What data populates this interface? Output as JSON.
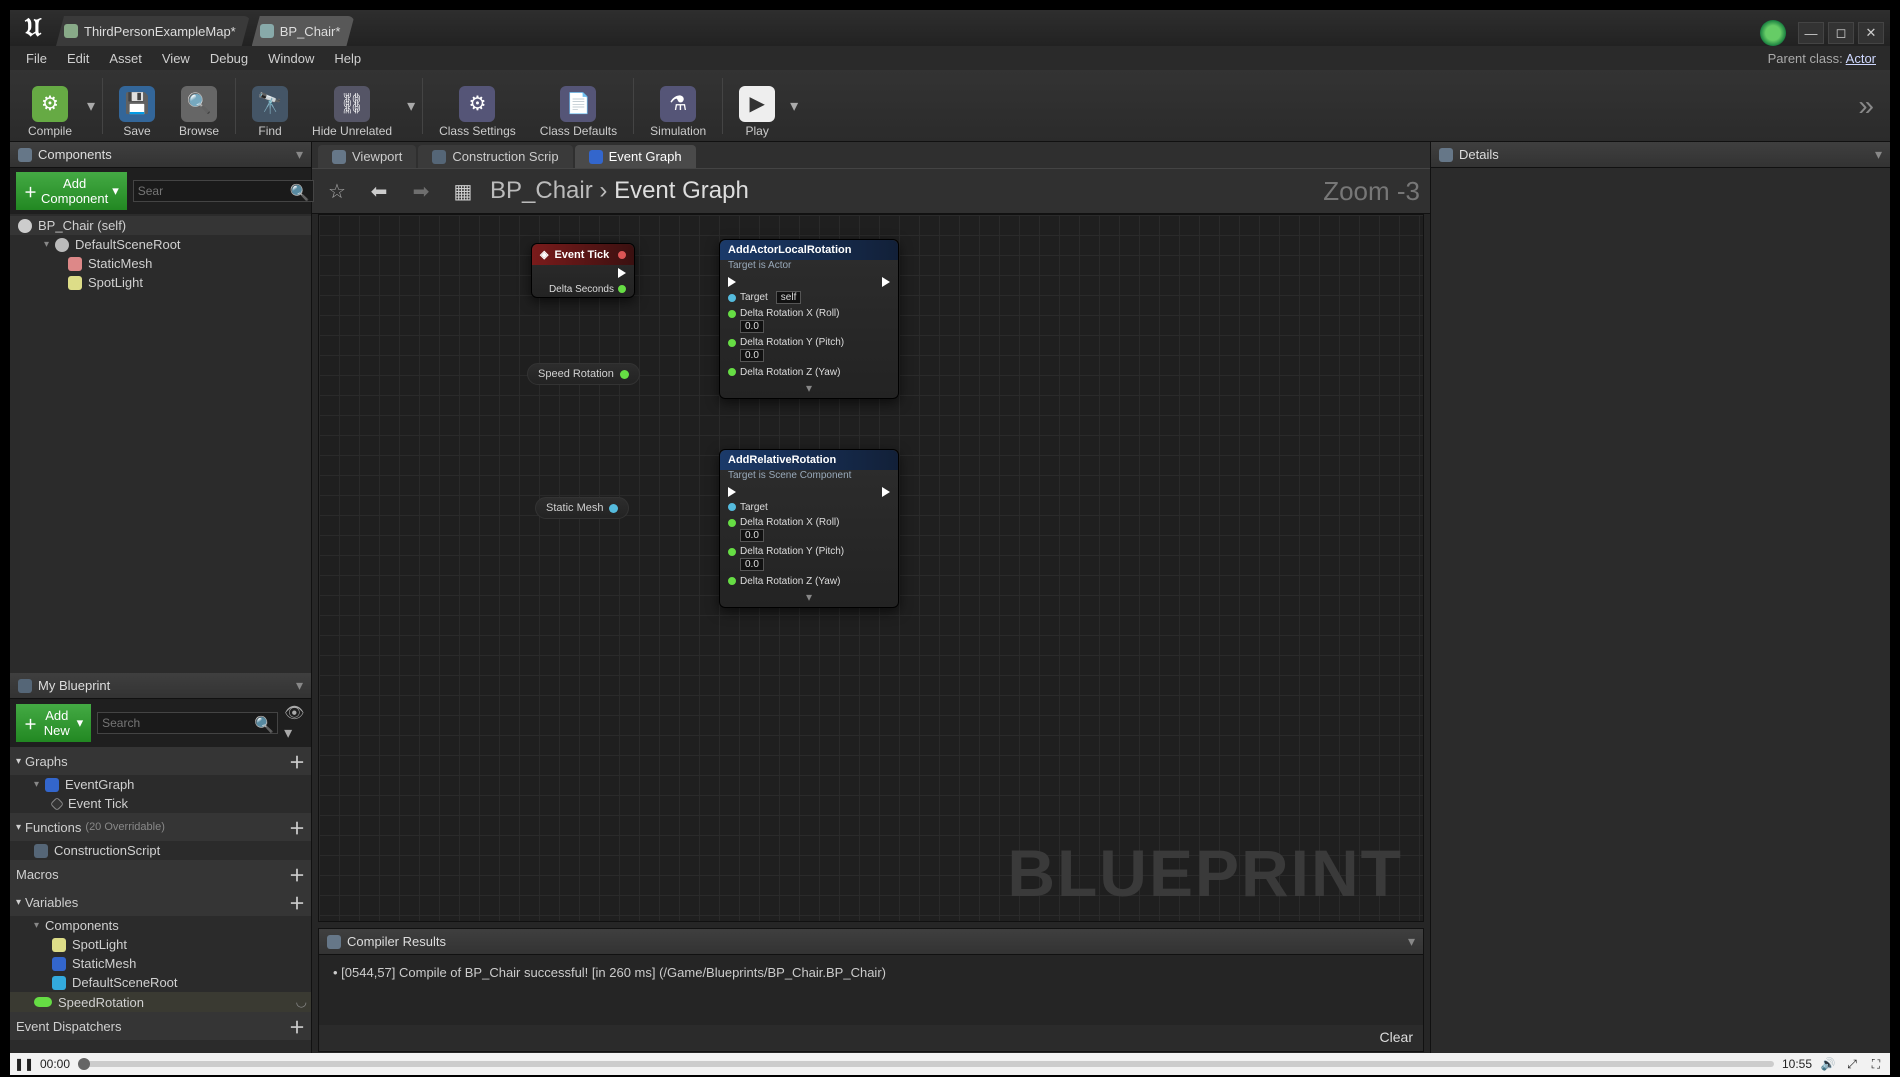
{
  "titlebar": {
    "tabs": [
      {
        "label": "ThirdPersonExampleMap*"
      },
      {
        "label": "BP_Chair*"
      }
    ]
  },
  "menubar": {
    "items": [
      "File",
      "Edit",
      "Asset",
      "View",
      "Debug",
      "Window",
      "Help"
    ],
    "parent_class_label": "Parent class:",
    "parent_class_value": "Actor"
  },
  "toolbar": {
    "compile": "Compile",
    "save": "Save",
    "browse": "Browse",
    "find": "Find",
    "hide_unrelated": "Hide Unrelated",
    "class_settings": "Class Settings",
    "class_defaults": "Class Defaults",
    "simulation": "Simulation",
    "play": "Play"
  },
  "left": {
    "components": {
      "title": "Components",
      "add_label": "Add Component",
      "search_placeholder": "Sear",
      "tree": {
        "self": "BP_Chair (self)",
        "root": "DefaultSceneRoot",
        "staticmesh": "StaticMesh",
        "spotlight": "SpotLight"
      }
    },
    "myblueprint": {
      "title": "My Blueprint",
      "addnew": "Add New",
      "search_placeholder": "Search",
      "sections": {
        "graphs": "Graphs",
        "eventgraph": "EventGraph",
        "eventtick": "Event Tick",
        "functions": "Functions",
        "functions_count": "(20 Overridable)",
        "construction": "ConstructionScript",
        "macros": "Macros",
        "variables": "Variables",
        "components_sub": "Components",
        "spotlight": "SpotLight",
        "staticmesh": "StaticMesh",
        "defscene": "DefaultSceneRoot",
        "speedrot": "SpeedRotation",
        "eventdispatchers": "Event Dispatchers"
      }
    }
  },
  "center": {
    "tabs": {
      "viewport": "Viewport",
      "construction": "Construction Scrip",
      "eventgraph": "Event Graph"
    },
    "nav": {
      "bp": "BP_Chair",
      "current": "Event Graph",
      "zoom": "Zoom -3"
    },
    "watermark": "BLUEPRINT",
    "nodes": {
      "event_tick": {
        "title": "Event Tick",
        "delta": "Delta Seconds"
      },
      "speed_rotation": "Speed Rotation",
      "static_mesh": "Static Mesh",
      "add_actor_local_rotation": {
        "title": "AddActorLocalRotation",
        "subtitle": "Target is Actor",
        "target": "Target",
        "self": "self",
        "drx": "Delta Rotation X (Roll)",
        "dry": "Delta Rotation Y (Pitch)",
        "drz": "Delta Rotation Z (Yaw)",
        "zero": "0.0"
      },
      "add_relative_rotation": {
        "title": "AddRelativeRotation",
        "subtitle": "Target is Scene Component",
        "target": "Target",
        "drx": "Delta Rotation X (Roll)",
        "dry": "Delta Rotation Y (Pitch)",
        "drz": "Delta Rotation Z (Yaw)",
        "zero": "0.0"
      }
    }
  },
  "compiler": {
    "title": "Compiler Results",
    "msg": "[0544,57] Compile of BP_Chair successful! [in 260 ms] (/Game/Blueprints/BP_Chair.BP_Chair)",
    "clear": "Clear"
  },
  "right": {
    "title": "Details"
  },
  "player": {
    "current": "00:00",
    "total": "10:55"
  }
}
